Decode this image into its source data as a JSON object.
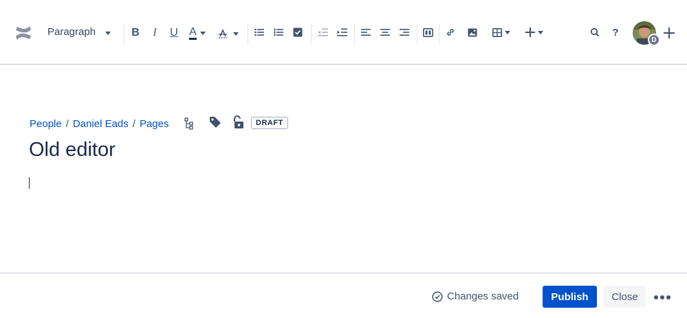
{
  "toolbar": {
    "logo_icon": "confluence-logo-icon",
    "paragraph_label": "Paragraph",
    "tools": [
      {
        "name": "bold-icon",
        "glyph": "B"
      },
      {
        "name": "italic-icon",
        "glyph": "I"
      },
      {
        "name": "underline-icon",
        "glyph": "U"
      },
      {
        "name": "text-color-icon",
        "glyph": "A"
      },
      {
        "name": "text-style-icon",
        "glyph": "A"
      }
    ],
    "avatar_initial": "D"
  },
  "breadcrumb": {
    "items": [
      "People",
      "Daniel Eads",
      "Pages"
    ],
    "separator": "/"
  },
  "draft_label": "DRAFT",
  "page_title": "Old editor",
  "footer": {
    "status": "Changes saved",
    "publish_label": "Publish",
    "close_label": "Close"
  },
  "colors": {
    "primary": "#0052cc",
    "text": "#172b4d",
    "icon": "#42526e",
    "border": "#c1c7d0"
  }
}
